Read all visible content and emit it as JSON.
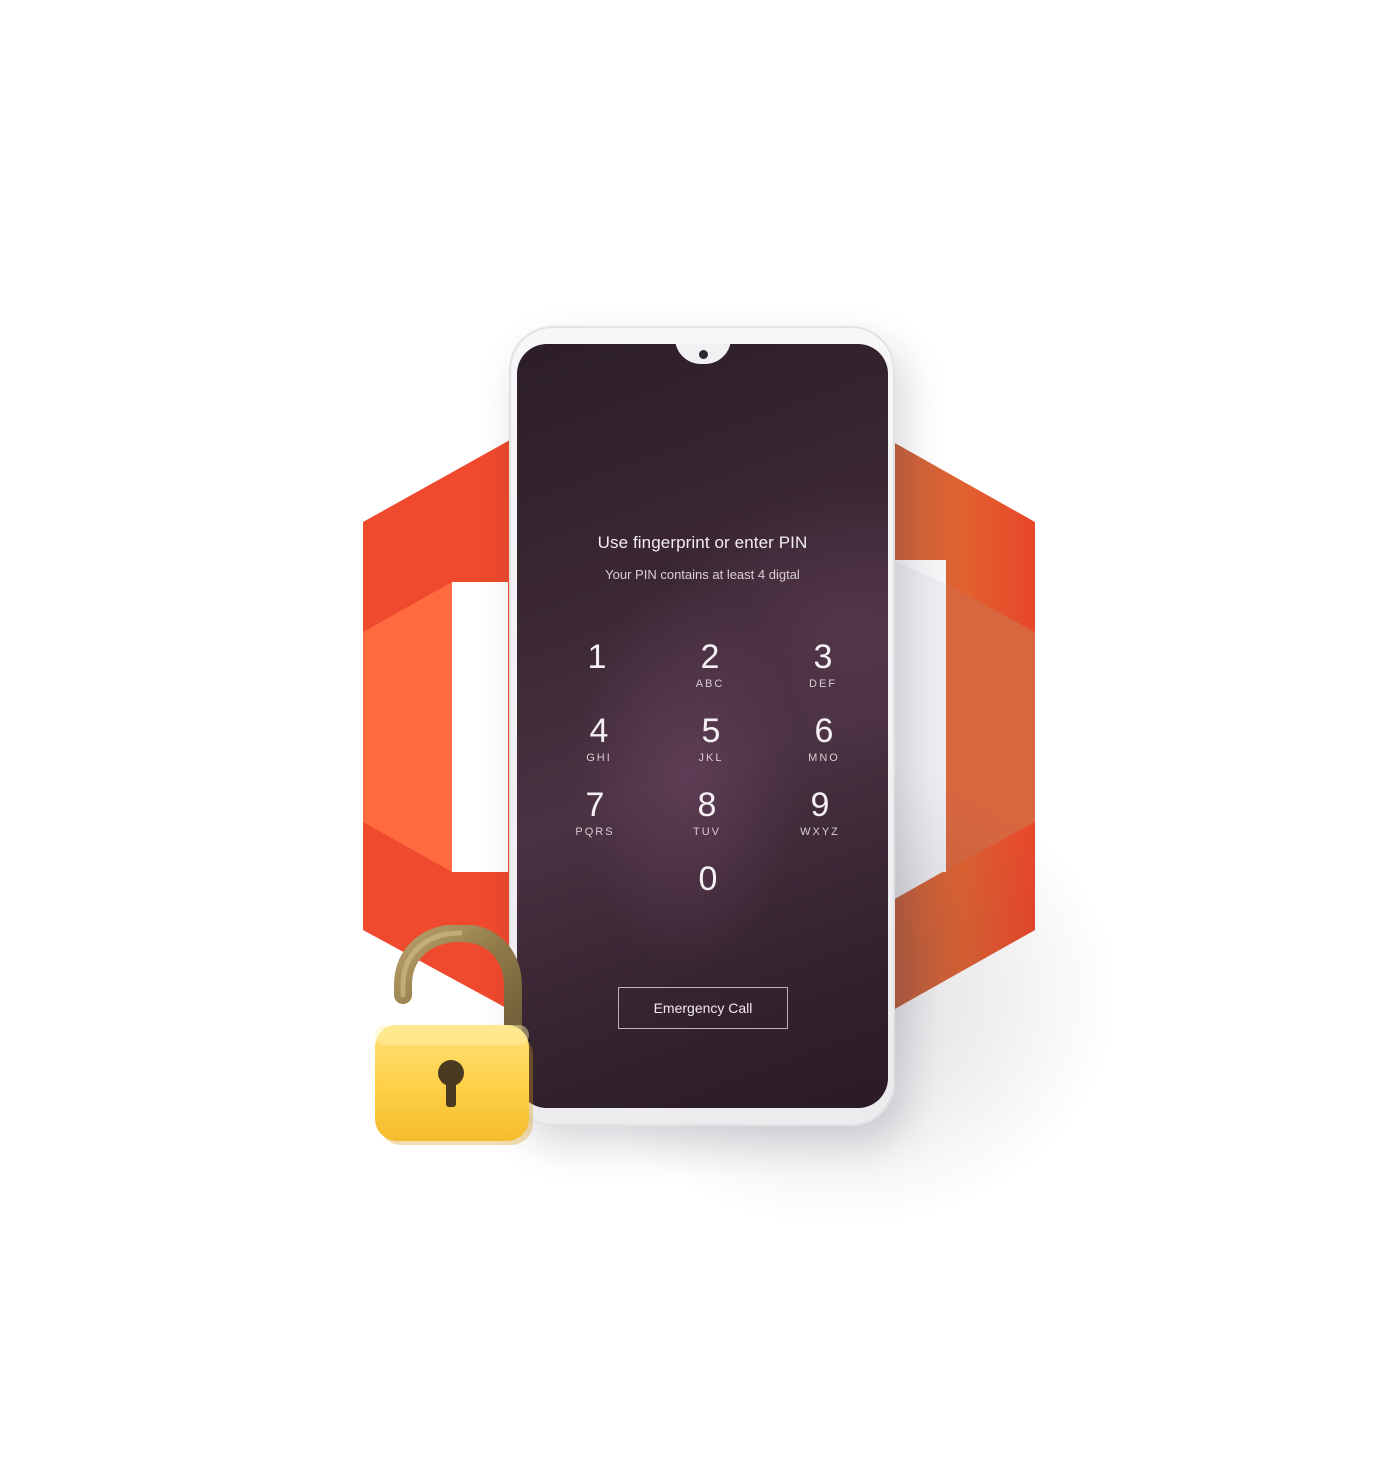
{
  "lock_screen": {
    "title": "Use fingerprint or enter PIN",
    "subtitle": "Your PIN contains at least 4 digtal",
    "keys": [
      {
        "digit": "1",
        "letters": ""
      },
      {
        "digit": "2",
        "letters": "ABC"
      },
      {
        "digit": "3",
        "letters": "DEF"
      },
      {
        "digit": "4",
        "letters": "GHI"
      },
      {
        "digit": "5",
        "letters": "JKL"
      },
      {
        "digit": "6",
        "letters": "MNO"
      },
      {
        "digit": "7",
        "letters": "PQRS"
      },
      {
        "digit": "8",
        "letters": "TUV"
      },
      {
        "digit": "9",
        "letters": "WXYZ"
      },
      {
        "digit": "0",
        "letters": ""
      }
    ],
    "emergency_label": "Emergency Call"
  },
  "colors": {
    "logo_orange": "#EF4B2E",
    "logo_light_orange": "#FF6A3D",
    "screen_bg": "#3A2733",
    "padlock_yellow": "#FFD24A",
    "shackle": "#9C8755"
  },
  "icons": [
    "office-logo-icon",
    "padlock-unlocked-icon",
    "front-camera-icon"
  ]
}
